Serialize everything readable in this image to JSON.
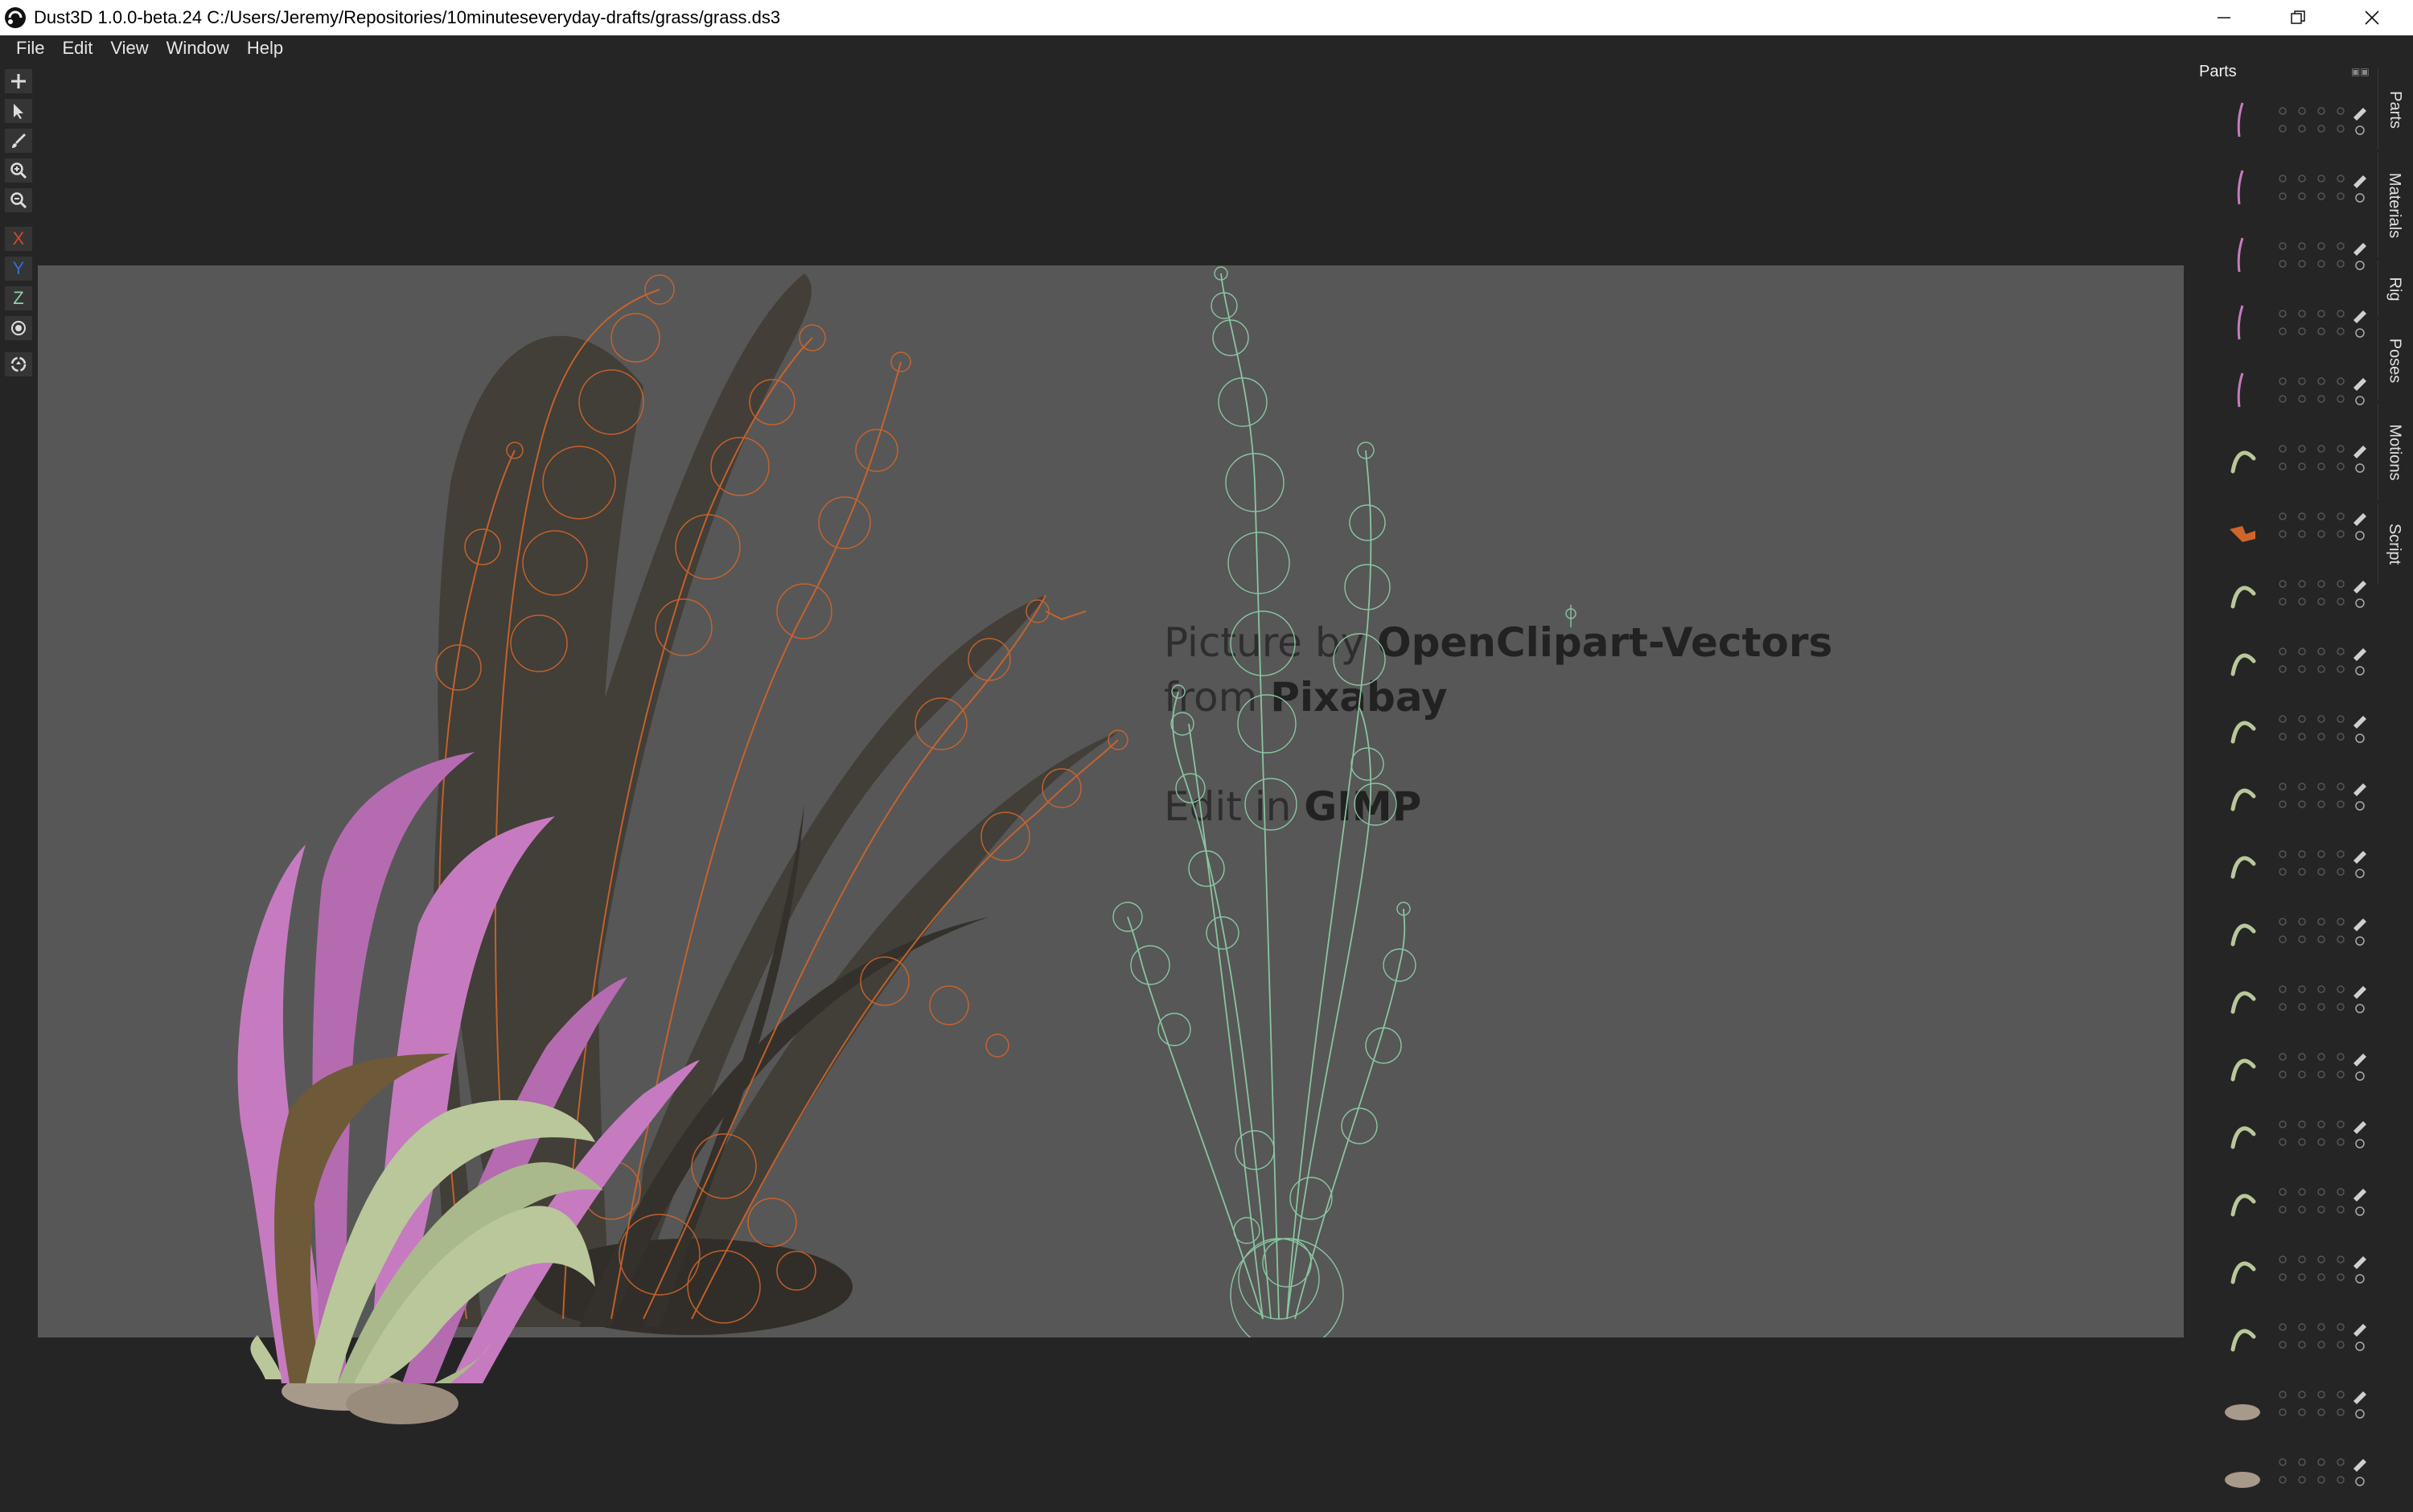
{
  "window": {
    "title": "Dust3D 1.0.0-beta.24 C:/Users/Jeremy/Repositories/10minuteseveryday-drafts/grass/grass.ds3",
    "controls": [
      "minimize",
      "restore",
      "close"
    ]
  },
  "menu": {
    "file": "File",
    "edit": "Edit",
    "view": "View",
    "window": "Window",
    "help": "Help"
  },
  "toolbar": {
    "tools": [
      "add-icon",
      "select-icon",
      "paint-brush-icon",
      "zoom-in-icon",
      "zoom-out-icon"
    ],
    "axis_x": "X",
    "axis_y": "Y",
    "axis_z": "Z",
    "colors": {
      "x": "#d8452a",
      "y": "#2f6fcf",
      "z": "#8fd0a8"
    }
  },
  "viewport": {
    "credit_line1_prefix": "Picture by ",
    "credit_line1_bold": "OpenClipart-Vectors",
    "credit_line2_prefix": "from ",
    "credit_line2_bold": "Pixabay",
    "credit_line3_prefix": "Edit in ",
    "credit_line3_bold": "GIMP",
    "colors": {
      "background": "#575757",
      "orange_nodes": "#d0652a",
      "green_nodes": "#8fd0a8",
      "pink_leaves": "#c67bc0",
      "pale_leaves": "#b9c79a"
    }
  },
  "parts_panel": {
    "title": "Parts",
    "parts": [
      {
        "shape": "pink-stroke"
      },
      {
        "shape": "pink-stroke"
      },
      {
        "shape": "pink-stroke"
      },
      {
        "shape": "pink-stroke"
      },
      {
        "shape": "pink-stroke"
      },
      {
        "shape": "pale-curve"
      },
      {
        "shape": "orange-selected"
      },
      {
        "shape": "pale-curve"
      },
      {
        "shape": "pale-curve"
      },
      {
        "shape": "pale-curve"
      },
      {
        "shape": "pale-curve"
      },
      {
        "shape": "pale-curve"
      },
      {
        "shape": "pale-curve"
      },
      {
        "shape": "pale-curve"
      },
      {
        "shape": "pale-curve"
      },
      {
        "shape": "pale-curve"
      },
      {
        "shape": "pale-curve"
      },
      {
        "shape": "pale-curve"
      },
      {
        "shape": "pale-curve"
      },
      {
        "shape": "rock"
      },
      {
        "shape": "rock"
      }
    ]
  },
  "dock_tabs": {
    "parts": "Parts",
    "materials": "Materials",
    "rig": "Rig",
    "poses": "Poses",
    "motions": "Motions",
    "script": "Script"
  }
}
